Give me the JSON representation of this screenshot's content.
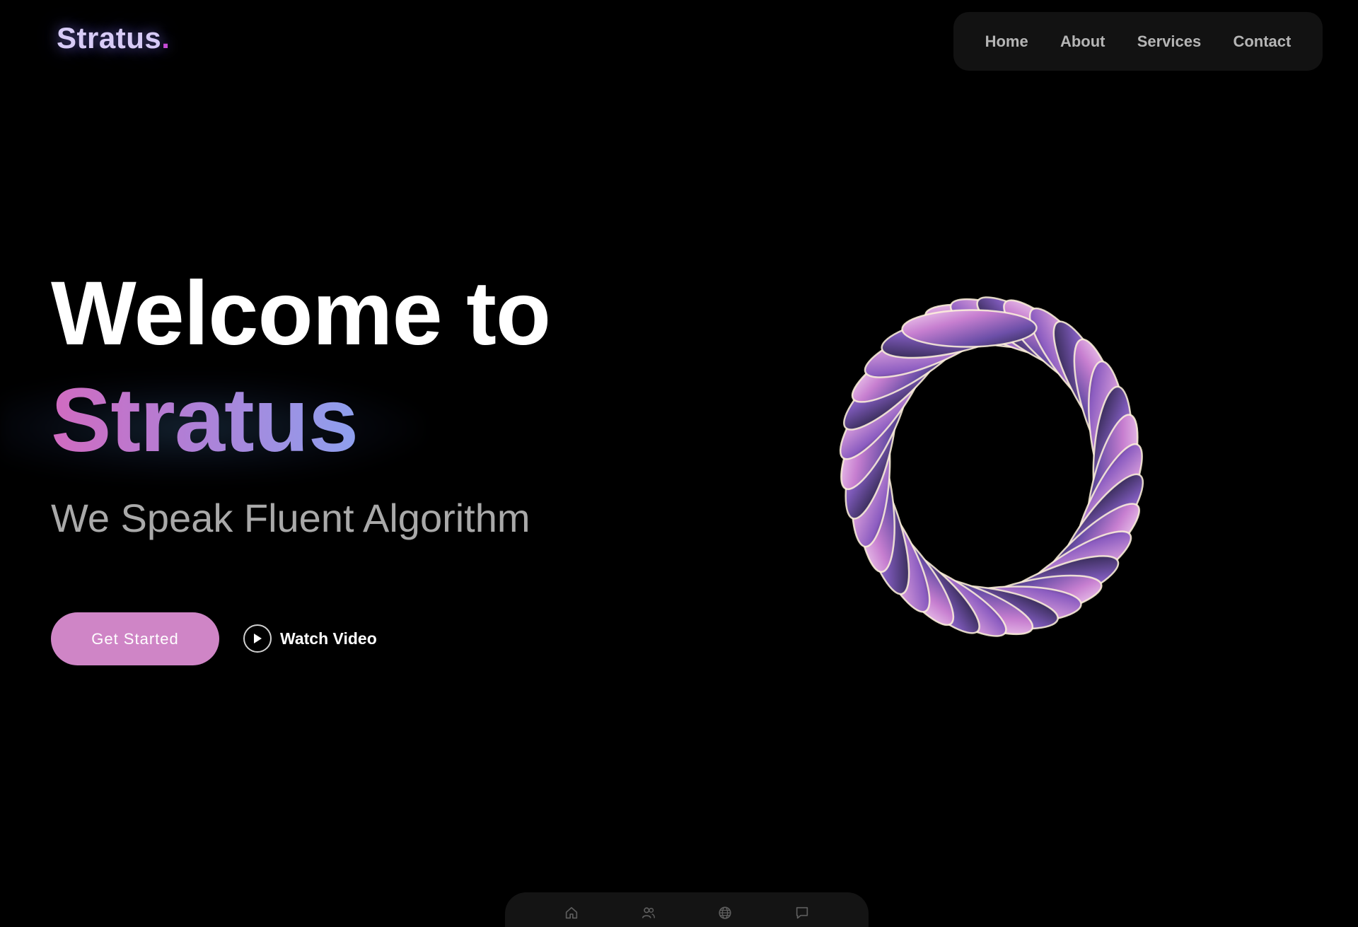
{
  "brand": {
    "name": "Stratus",
    "dot": "."
  },
  "nav": {
    "items": [
      {
        "label": "Home"
      },
      {
        "label": "About"
      },
      {
        "label": "Services"
      },
      {
        "label": "Contact"
      }
    ]
  },
  "hero": {
    "title": "Welcome to",
    "brand": "Stratus",
    "tagline": "We Speak Fluent Algorithm"
  },
  "actions": {
    "primary_label": "Get Started",
    "video_label": "Watch Video",
    "video_icon": "play-circle-icon"
  },
  "dock": {
    "icons": [
      "home-icon",
      "users-icon",
      "globe-icon",
      "chat-icon"
    ]
  },
  "colors": {
    "background": "#000000",
    "primary_button": "#cf85c6",
    "brand_gradient_start": "#d16bc0",
    "brand_gradient_end": "#8ea0ee",
    "nav_background": "#121212"
  }
}
